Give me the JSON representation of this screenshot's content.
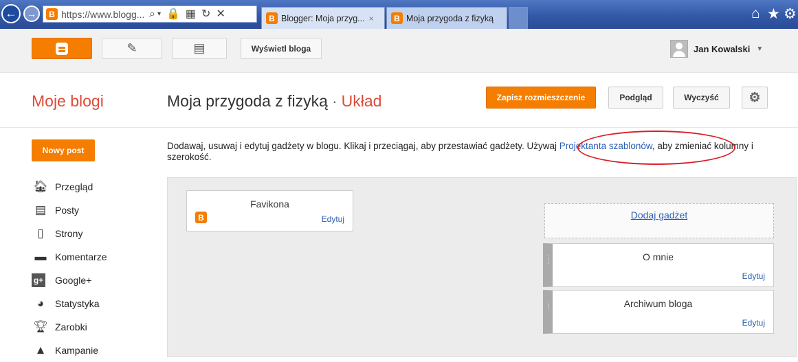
{
  "browser": {
    "back_icon": "back-arrow-icon",
    "forward_icon": "forward-arrow-icon",
    "url": "https://www.blogg...",
    "tabs": [
      {
        "label": "Blogger: Moja przyg...",
        "close": "×"
      },
      {
        "label": "Moja przygoda z fizyką"
      }
    ]
  },
  "topbar": {
    "view_blog": "Wyświetl bloga",
    "user_name": "Jan Kowalski"
  },
  "header": {
    "my_blogs": "Moje blogi",
    "blog_name": "Moja przygoda z fizyką",
    "separator": "·",
    "section": "Układ",
    "save_layout": "Zapisz rozmieszczenie",
    "preview": "Podgląd",
    "clear": "Wyczyść"
  },
  "sidebar": {
    "new_post": "Nowy post",
    "items": [
      {
        "label": "Przegląd",
        "icon": "home-icon"
      },
      {
        "label": "Posty",
        "icon": "posts-icon"
      },
      {
        "label": "Strony",
        "icon": "pages-icon"
      },
      {
        "label": "Komentarze",
        "icon": "comments-icon"
      },
      {
        "label": "Google+",
        "icon": "google-plus-icon"
      },
      {
        "label": "Statystyka",
        "icon": "stats-icon"
      },
      {
        "label": "Zarobki",
        "icon": "trophy-icon"
      },
      {
        "label": "Kampanie",
        "icon": "campaigns-icon"
      }
    ]
  },
  "layout": {
    "desc_before": "Dodawaj, usuwaj i edytuj gadżety w blogu. Klikaj i przeciągaj, aby przestawiać gadżety. Używaj ",
    "desc_link": "Projektanta szablonów",
    "desc_after": ", aby zmieniać kolumny i szerokość.",
    "gadgets": {
      "favicon": {
        "title": "Favikona",
        "edit": "Edytuj"
      },
      "add": "Dodaj gadżet",
      "about": {
        "title": "O mnie",
        "edit": "Edytuj"
      },
      "archive": {
        "title": "Archiwum bloga",
        "edit": "Edytuj"
      }
    }
  },
  "colors": {
    "accent": "#f57d00",
    "title_accent": "#dd4b39",
    "link": "#2a5db0",
    "annotation": "#d92028"
  }
}
